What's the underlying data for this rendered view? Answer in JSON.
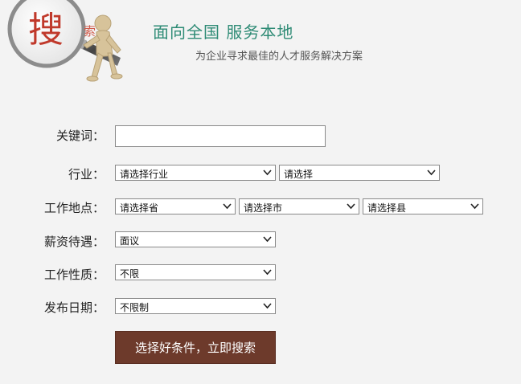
{
  "header": {
    "logo_char_big": "搜",
    "logo_char_small": "索",
    "headline": "面向全国  服务本地",
    "subline": "为企业寻求最佳的人才服务解决方案"
  },
  "form": {
    "keyword": {
      "label": "关键词：",
      "value": ""
    },
    "industry": {
      "label": "行业：",
      "select1": "请选择行业",
      "select2": "请选择"
    },
    "location": {
      "label": "工作地点：",
      "province": "请选择省",
      "city": "请选择市",
      "county": "请选择县"
    },
    "salary": {
      "label": "薪资待遇：",
      "value": "面议"
    },
    "job_type": {
      "label": "工作性质：",
      "value": "不限"
    },
    "post_date": {
      "label": "发布日期：",
      "value": "不限制"
    },
    "submit_label": "选择好条件，立即搜索"
  },
  "colors": {
    "headline": "#2e8b75",
    "button_bg": "#6d3a2b",
    "logo_red": "#c0392b"
  }
}
